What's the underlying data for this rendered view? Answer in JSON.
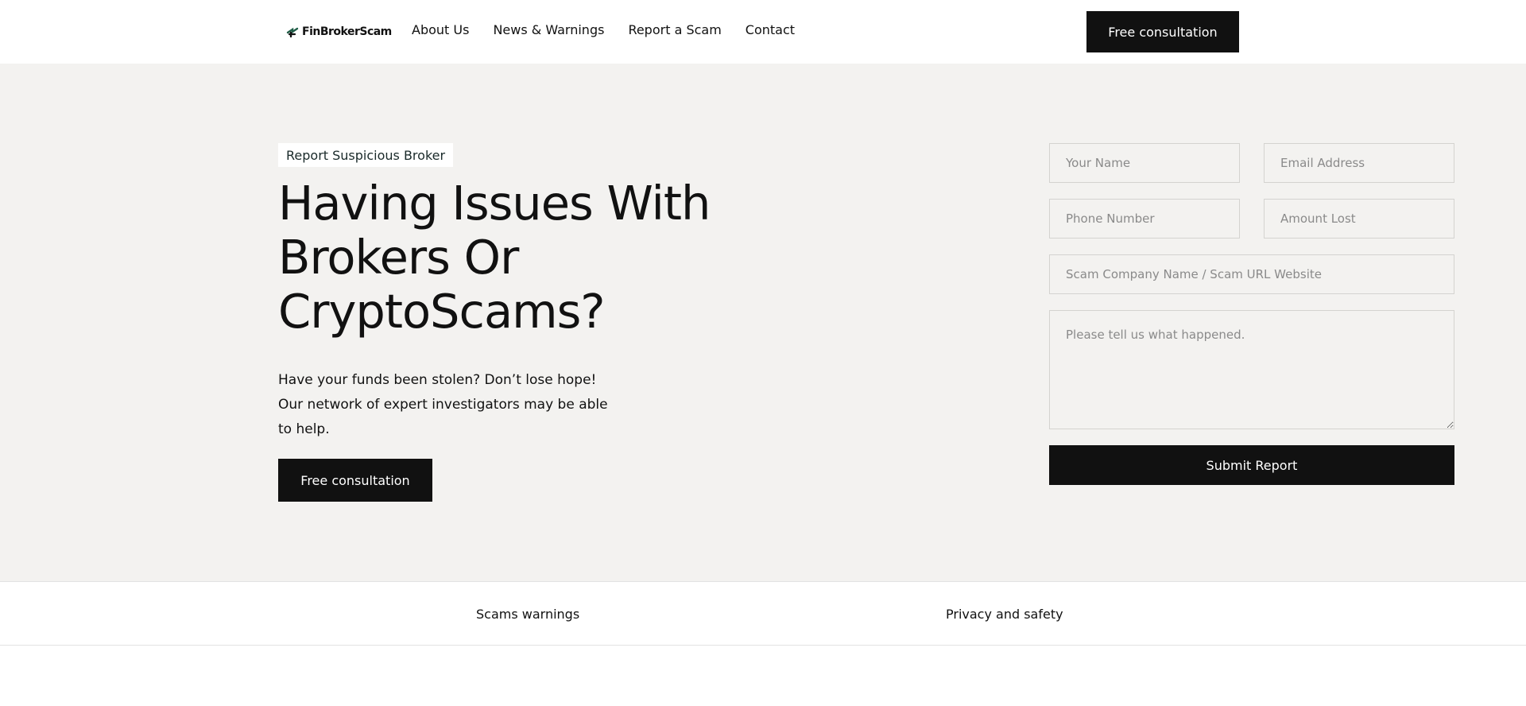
{
  "header": {
    "logo_text": "FinBrokerScam",
    "nav": [
      "About Us",
      "News & Warnings",
      "Report a Scam",
      "Contact"
    ],
    "cta_label": "Free consultation"
  },
  "hero": {
    "badge": "Report Suspicious Broker",
    "title": "Having Issues With Brokers Or CryptoScams?",
    "description": "Have your funds been stolen? Don’t lose hope! Our network of expert investigators may be able to help.",
    "cta_label": "Free consultation"
  },
  "form": {
    "name_placeholder": "Your Name",
    "email_placeholder": "Email Address",
    "phone_placeholder": "Phone Number",
    "amount_placeholder": "Amount Lost",
    "company_placeholder": "Scam Company Name / Scam URL Website",
    "message_placeholder": "Please tell us what happened.",
    "submit_label": "Submit Report"
  },
  "footer": {
    "links": [
      "Scams warnings",
      "Privacy and safety"
    ]
  },
  "colors": {
    "accent": "#111111",
    "hero_bg": "#f3f2f0",
    "logo_icon": "#1f5d47"
  }
}
